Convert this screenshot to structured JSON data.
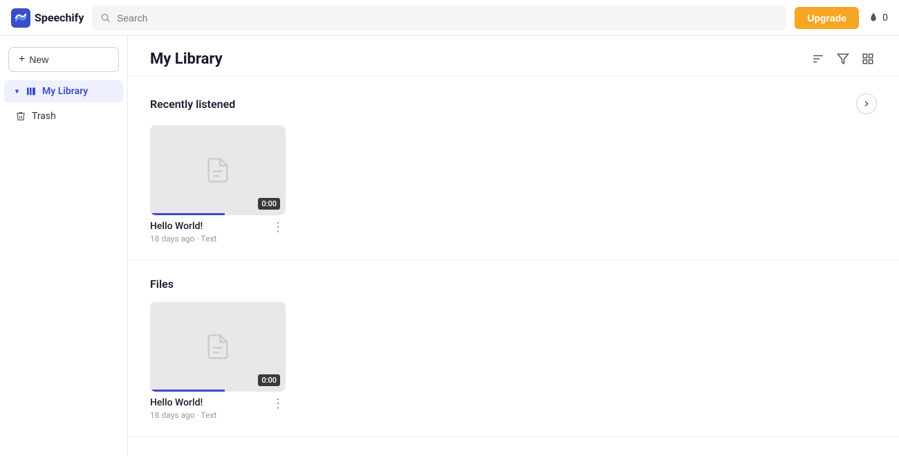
{
  "app": {
    "name": "Speechify"
  },
  "topbar": {
    "search_placeholder": "Search",
    "upgrade_label": "Upgrade",
    "credits": "0"
  },
  "sidebar": {
    "new_label": "New",
    "items": [
      {
        "id": "my-library",
        "label": "My Library",
        "icon": "library",
        "active": true
      },
      {
        "id": "trash",
        "label": "Trash",
        "icon": "trash",
        "active": false
      }
    ]
  },
  "main": {
    "title": "My Library",
    "sections": [
      {
        "id": "recently-listened",
        "title": "Recently listened",
        "items": [
          {
            "title": "Hello World!",
            "meta_time": "18 days ago",
            "meta_type": "Text",
            "duration": "0:00"
          }
        ]
      },
      {
        "id": "files",
        "title": "Files",
        "items": [
          {
            "title": "Hello World!",
            "meta_time": "18 days ago",
            "meta_type": "Text",
            "duration": "0:00"
          }
        ]
      }
    ]
  }
}
